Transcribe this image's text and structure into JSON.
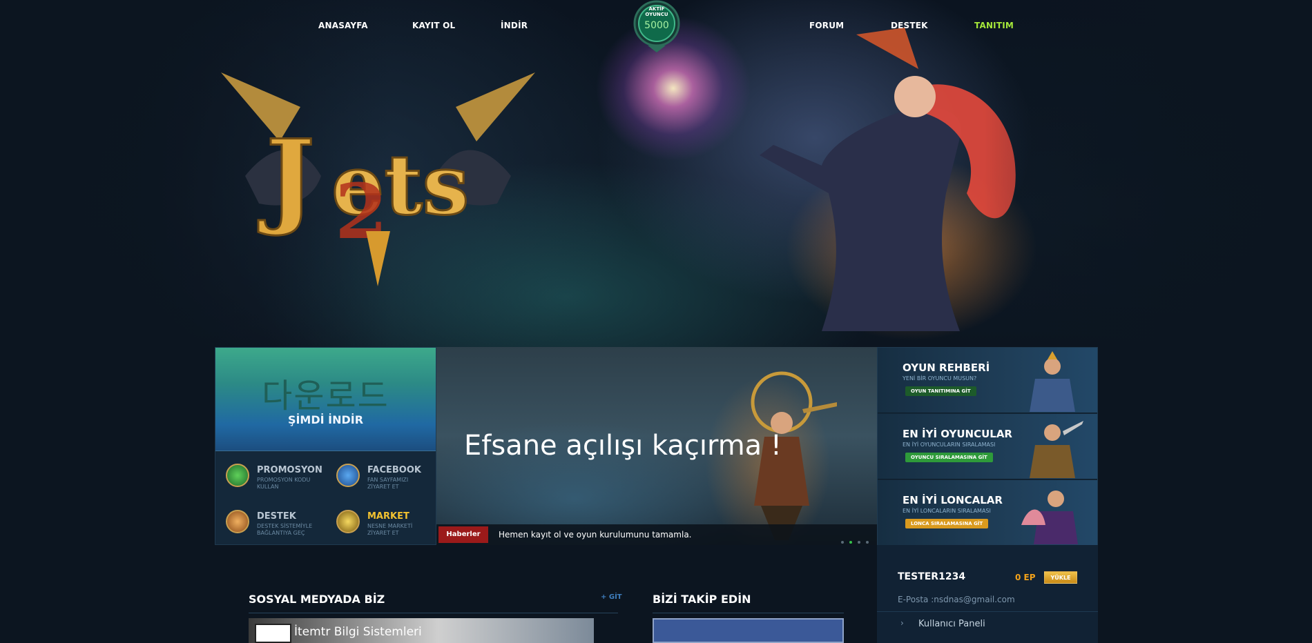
{
  "nav": {
    "left": [
      "ANASAYFA",
      "KAYIT OL",
      "İNDİR"
    ],
    "right": [
      "FORUM",
      "DESTEK",
      "TANITIM"
    ]
  },
  "badge": {
    "caption_1": "AKTİF",
    "caption_2": "OYUNCU",
    "count": "5000"
  },
  "download": {
    "korean": "다운로드",
    "label": "ŞİMDİ İNDİR"
  },
  "quick_links": [
    {
      "title": "PROMOSYON",
      "sub1": "PROMOSYON KODU",
      "sub2": "KULLAN"
    },
    {
      "title": "FACEBOOK",
      "sub1": "FAN SAYFAMIZI",
      "sub2": "ZİYARET ET"
    },
    {
      "title": "DESTEK",
      "sub1": "DESTEK SİSTEMİYLE",
      "sub2": "BAĞLANTIYA GEÇ"
    },
    {
      "title": "MARKET",
      "sub1": "NESNE MARKETİ",
      "sub2": "ZİYARET ET"
    }
  ],
  "slider": {
    "headline": "Efsane açılışı kaçırma !",
    "tag": "Haberler",
    "news": "Hemen kayıt ol ve oyun kurulumunu tamamla.",
    "dots": 4,
    "active_dot": 1
  },
  "cards": [
    {
      "title": "OYUN REHBERİ",
      "sub": "YENİ BİR OYUNCU MUSUN?",
      "button": "OYUN TANITIMINA GİT",
      "color": "#1d5b2a"
    },
    {
      "title": "EN İYİ OYUNCULAR",
      "sub": "EN İYİ OYUNCULARIN SIRALAMASI",
      "button": "OYUNCU SIRALAMASINA GİT",
      "color": "#2e9a3a"
    },
    {
      "title": "EN İYİ LONCALAR",
      "sub": "EN İYİ LONCALARIN SIRALAMASI",
      "button": "LONCA SIRALAMASINA GİT",
      "color": "#d99a1e"
    }
  ],
  "social": {
    "title": "SOSYAL MEDYADA BİZ",
    "link": "+ GİT",
    "video_title": "İtemtr Bilgi Sistemleri"
  },
  "follow": {
    "title": "BİZİ TAKİP EDİN"
  },
  "user": {
    "name": "TESTER1234",
    "ep": "0 EP",
    "load_button": "YÜKLE",
    "email": "E-Posta :nsdnas@gmail.com",
    "panel_link": "Kullanıcı Paneli"
  },
  "colors": {
    "active_nav": "#a6e83a",
    "gold": "#f2c230",
    "ep": "#f2a21a"
  }
}
